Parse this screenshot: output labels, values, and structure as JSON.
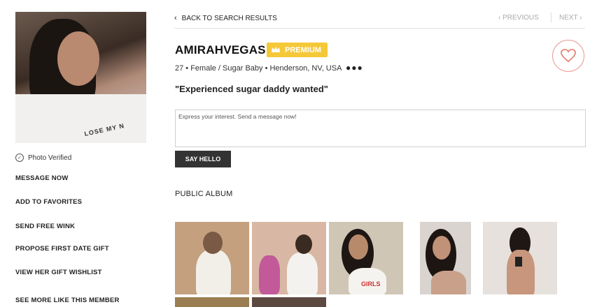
{
  "nav": {
    "back_label": "BACK TO SEARCH RESULTS",
    "previous_label": "PREVIOUS",
    "next_label": "NEXT"
  },
  "profile": {
    "username": "AMIRAHVEGAS",
    "badge": "PREMIUM",
    "meta": "27 • Female / Sugar Baby • Henderson, NV, USA",
    "headline": "\"Experienced sugar daddy wanted\"",
    "photo_shirt_text": "LOSE MY N",
    "photo_verified": "Photo Verified"
  },
  "actions": {
    "message_now": "MESSAGE NOW",
    "add_favorites": "ADD TO FAVORITES",
    "send_wink": "SEND FREE WINK",
    "propose_gift": "PROPOSE FIRST DATE GIFT",
    "view_wishlist": "VIEW HER GIFT WISHLIST",
    "see_more": "SEE MORE LIKE THIS MEMBER"
  },
  "message": {
    "placeholder": "Express your interest. Send a message now!",
    "button": "SAY HELLO"
  },
  "album": {
    "title": "PUBLIC ALBUM",
    "thumb3_text": "GIRLS"
  },
  "colors": {
    "premium": "#f5c838",
    "heart": "#e27a6c",
    "button_dark": "#333333"
  },
  "icons": [
    "chevron-left-icon",
    "chevron-right-icon",
    "crown-icon",
    "heart-icon",
    "check-circle-icon",
    "more-dots-icon"
  ]
}
